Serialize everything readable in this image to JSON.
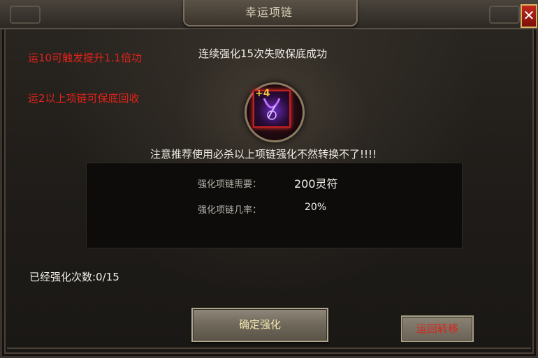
{
  "window": {
    "title": "幸运项链",
    "close_label": "✕"
  },
  "notes": {
    "line1": "运10可触发提升1.1倍功",
    "line2": "运2以上项链可保底回收"
  },
  "header_text": "连续强化15次失败保底成功",
  "item": {
    "level_badge": "+4",
    "icon": "necklace-icon"
  },
  "warning": "注意推荐使用必杀以上项链强化不然转换不了!!!!",
  "requirements": {
    "cost_label": "强化项链需要：",
    "cost_value": "200灵符",
    "rate_label": "强化项链几率：",
    "rate_value": "20%"
  },
  "progress_text": "已经强化次数:0/15",
  "buttons": {
    "confirm": "确定强化",
    "transfer": "运回转移"
  },
  "colors": {
    "warning_red": "#e0231b",
    "text": "#f2efe8",
    "gold": "#f2e6b0"
  }
}
